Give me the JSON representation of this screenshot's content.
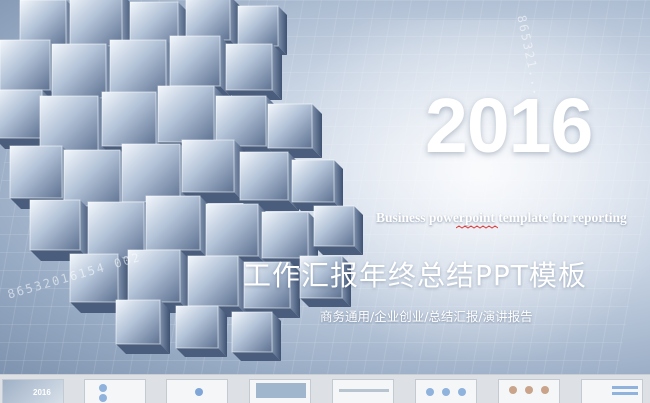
{
  "slide": {
    "year": "2016",
    "subtitle_en": "Business powerpoint template for reporting",
    "title_cn": "工作汇报年终总结PPT模板",
    "tags_cn": "商务通用/企业创业/总结汇报/演讲报告",
    "deco_digits_top": "865321...",
    "deco_digits_bottom": "86532016154 002"
  },
  "thumbnails": [
    {
      "label": "2016",
      "active": true
    },
    {
      "label": ""
    },
    {
      "label": ""
    },
    {
      "label": ""
    },
    {
      "label": ""
    },
    {
      "label": ""
    },
    {
      "label": ""
    },
    {
      "label": ""
    }
  ],
  "colors": {
    "text": "#ffffff",
    "slide_dark": "#6f84a2",
    "slide_light": "#e9eef6",
    "strip_bg": "#dde1e6"
  }
}
